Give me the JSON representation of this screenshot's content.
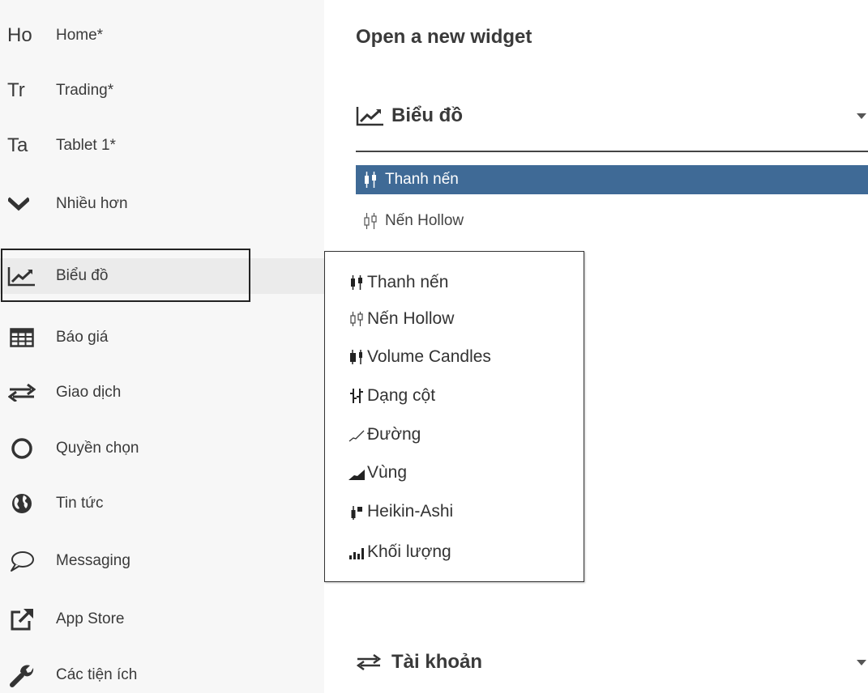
{
  "sidebar": {
    "workspaces": [
      {
        "abbr": "Ho",
        "label": "Home*"
      },
      {
        "abbr": "Tr",
        "label": "Trading*"
      },
      {
        "abbr": "Ta",
        "label": "Tablet 1*"
      }
    ],
    "more_label": "Nhiều hơn",
    "menu": [
      {
        "label": "Biểu đồ",
        "icon": "line-chart-icon",
        "active": true
      },
      {
        "label": "Báo giá",
        "icon": "table-grid-icon"
      },
      {
        "label": "Giao dịch",
        "icon": "swap-arrows-icon"
      },
      {
        "label": "Quyền chọn",
        "icon": "circle-icon"
      },
      {
        "label": "Tin tức",
        "icon": "globe-icon"
      },
      {
        "label": "Messaging",
        "icon": "speech-bubble-icon"
      },
      {
        "label": "App Store",
        "icon": "external-link-icon"
      },
      {
        "label": "Các tiện ích",
        "icon": "wrench-icon"
      }
    ]
  },
  "main": {
    "title": "Open a new widget",
    "sections": [
      {
        "label": "Biểu đồ",
        "icon": "line-chart-icon",
        "expanded": true
      },
      {
        "label": "Tài khoản",
        "icon": "swap-arrows-icon",
        "expanded": false
      }
    ],
    "chart_options": [
      {
        "label": "Thanh nến",
        "icon": "candlestick-icon",
        "selected": true
      },
      {
        "label": "Nến Hollow",
        "icon": "hollow-candle-icon",
        "selected": false
      }
    ]
  },
  "dropdown": {
    "items": [
      {
        "label": "Thanh nến",
        "icon": "candlestick-icon"
      },
      {
        "label": "Nến Hollow",
        "icon": "hollow-candle-icon"
      },
      {
        "label": "Volume Candles",
        "icon": "volume-candle-icon"
      },
      {
        "label": "Dạng cột",
        "icon": "ohlc-bar-icon"
      },
      {
        "label": "Đường",
        "icon": "line-icon"
      },
      {
        "label": "Vùng",
        "icon": "area-icon"
      },
      {
        "label": "Heikin-Ashi",
        "icon": "heikin-ashi-icon"
      },
      {
        "label": "Khối lượng",
        "icon": "volume-bars-icon"
      }
    ]
  },
  "colors": {
    "selected_bg": "#3f6a96",
    "sidebar_bg": "#f7f7f7",
    "active_bg": "#ebebeb",
    "text": "#3a3a3a"
  }
}
